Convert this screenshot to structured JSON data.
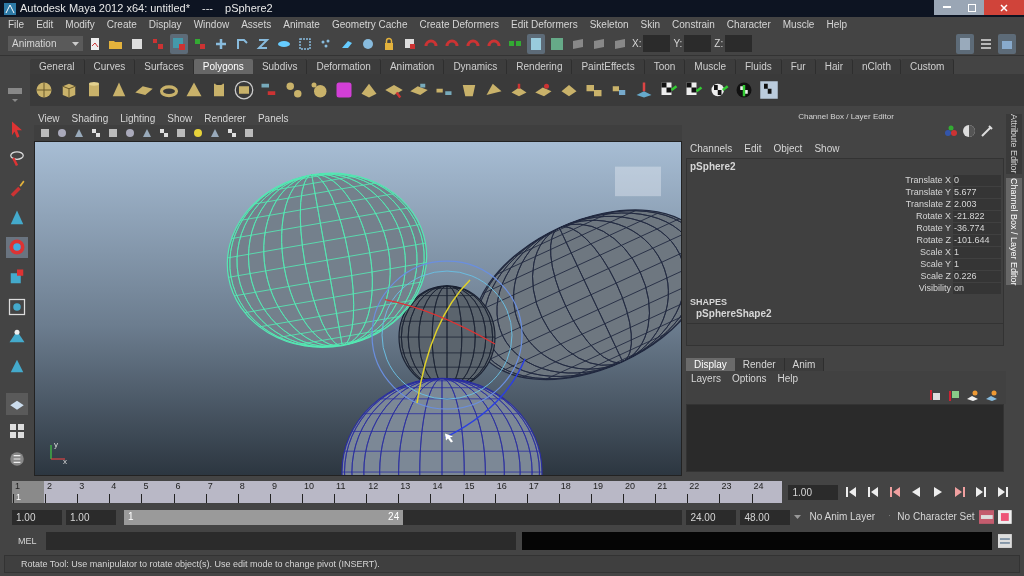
{
  "window": {
    "title": "Autodesk Maya 2012 x64: untitled*",
    "separator": "---",
    "object": "pSphere2"
  },
  "menu_bar": [
    "File",
    "Edit",
    "Modify",
    "Create",
    "Display",
    "Window",
    "Assets",
    "Animate",
    "Geometry Cache",
    "Create Deformers",
    "Edit Deformers",
    "Skeleton",
    "Skin",
    "Constrain",
    "Character",
    "Muscle",
    "Help"
  ],
  "status_line": {
    "mode": "Animation",
    "coords": [
      "X:",
      "Y:",
      "Z:"
    ]
  },
  "shelf": {
    "tabs": [
      {
        "label": "General",
        "selected": false
      },
      {
        "label": "Curves",
        "selected": false
      },
      {
        "label": "Surfaces",
        "selected": false
      },
      {
        "label": "Polygons",
        "selected": true
      },
      {
        "label": "Subdivs",
        "selected": false
      },
      {
        "label": "Deformation",
        "selected": false
      },
      {
        "label": "Animation",
        "selected": false
      },
      {
        "label": "Dynamics",
        "selected": false
      },
      {
        "label": "Rendering",
        "selected": false
      },
      {
        "label": "PaintEffects",
        "selected": false
      },
      {
        "label": "Toon",
        "selected": false
      },
      {
        "label": "Muscle",
        "selected": false
      },
      {
        "label": "Fluids",
        "selected": false
      },
      {
        "label": "Fur",
        "selected": false
      },
      {
        "label": "Hair",
        "selected": false
      },
      {
        "label": "nCloth",
        "selected": false
      },
      {
        "label": "Custom",
        "selected": false
      }
    ]
  },
  "viewport": {
    "menu": [
      "View",
      "Shading",
      "Lighting",
      "Show",
      "Renderer",
      "Panels"
    ],
    "axis": [
      "y",
      "x"
    ]
  },
  "channel_box": {
    "title": "Channel Box / Layer Editor",
    "menu": [
      "Channels",
      "Edit",
      "Object",
      "Show"
    ],
    "object": "pSphere2",
    "attributes": [
      {
        "name": "Translate X",
        "value": "0"
      },
      {
        "name": "Translate Y",
        "value": "5.677"
      },
      {
        "name": "Translate Z",
        "value": "2.003"
      },
      {
        "name": "Rotate X",
        "value": "-21.822"
      },
      {
        "name": "Rotate Y",
        "value": "-36.774"
      },
      {
        "name": "Rotate Z",
        "value": "-101.644"
      },
      {
        "name": "Scale X",
        "value": "1"
      },
      {
        "name": "Scale Y",
        "value": "1"
      },
      {
        "name": "Scale Z",
        "value": "0.226"
      },
      {
        "name": "Visibility",
        "value": "on"
      }
    ],
    "shapes_heading": "SHAPES",
    "shape": "pSphereShape2"
  },
  "layer_editor": {
    "tabs": [
      {
        "label": "Display",
        "selected": true
      },
      {
        "label": "Render",
        "selected": false
      },
      {
        "label": "Anim",
        "selected": false
      }
    ],
    "menu": [
      "Layers",
      "Options",
      "Help"
    ]
  },
  "side_tabs": [
    {
      "label": "Attribute Editor",
      "selected": false
    },
    {
      "label": "Channel Box / Layer Editor",
      "selected": true
    }
  ],
  "time_slider": {
    "ticks": [
      {
        "label": "1",
        "selected": true
      },
      {
        "label": "2",
        "selected": false
      },
      {
        "label": "3",
        "selected": false
      },
      {
        "label": "4",
        "selected": false
      },
      {
        "label": "5",
        "selected": false
      },
      {
        "label": "6",
        "selected": false
      },
      {
        "label": "7",
        "selected": false
      },
      {
        "label": "8",
        "selected": false
      },
      {
        "label": "9",
        "selected": false
      },
      {
        "label": "10",
        "selected": false
      },
      {
        "label": "11",
        "selected": false
      },
      {
        "label": "12",
        "selected": false
      },
      {
        "label": "13",
        "selected": false
      },
      {
        "label": "14",
        "selected": false
      },
      {
        "label": "15",
        "selected": false
      },
      {
        "label": "16",
        "selected": false
      },
      {
        "label": "17",
        "selected": false
      },
      {
        "label": "18",
        "selected": false
      },
      {
        "label": "19",
        "selected": false
      },
      {
        "label": "20",
        "selected": false
      },
      {
        "label": "21",
        "selected": false
      },
      {
        "label": "22",
        "selected": false
      },
      {
        "label": "23",
        "selected": false
      },
      {
        "label": "24",
        "selected": false
      }
    ],
    "current_frame": "1",
    "current_time": "1.00"
  },
  "range_slider": {
    "level": 0.5,
    "start": "1.00",
    "playback_start": "1.00",
    "range_start": "1",
    "range_end": "24",
    "playback_end": "24.00",
    "end": "48.00",
    "anim_layer": "No Anim Layer",
    "character_set": "No Character Set"
  },
  "command_line": {
    "language": "MEL"
  },
  "help_line": "Rotate Tool: Use manipulator to rotate object(s). Use edit mode to change pivot (INSERT)."
}
